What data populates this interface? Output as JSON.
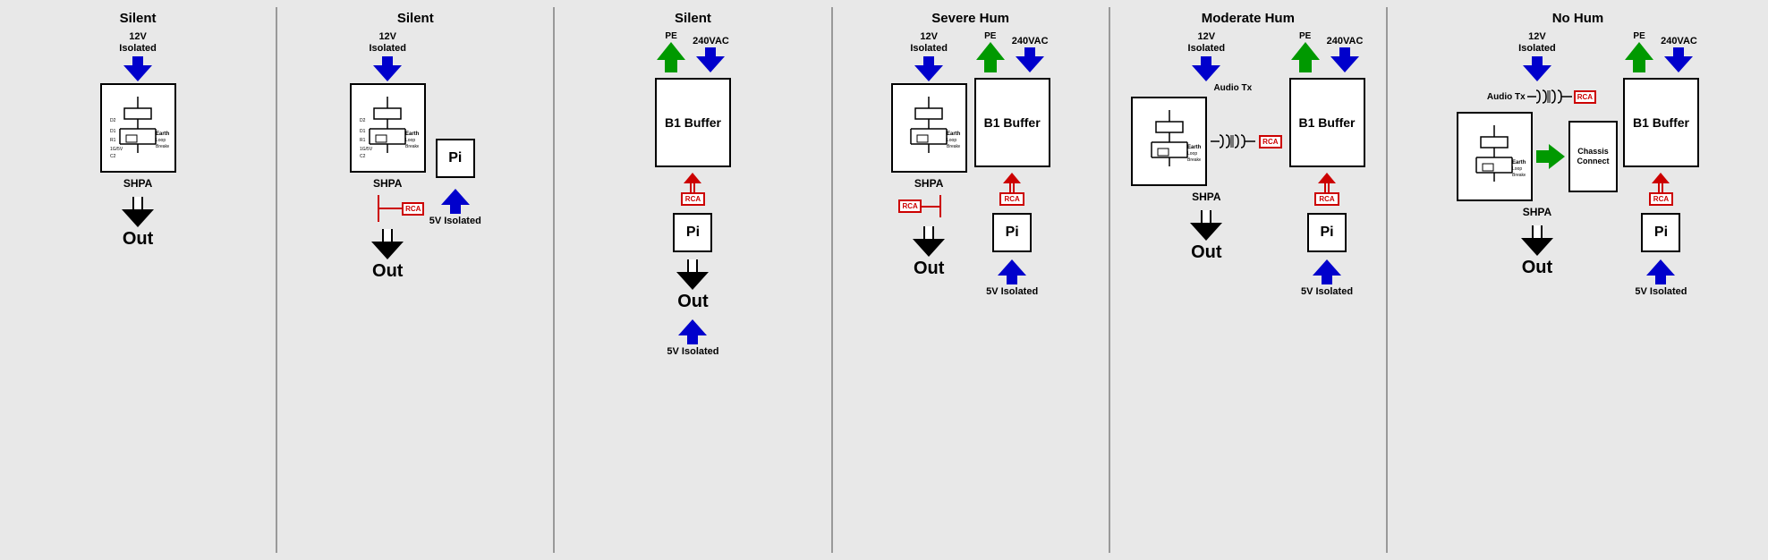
{
  "scenarios": [
    {
      "id": "s1",
      "title": "Silent",
      "columns": [
        {
          "type": "shpa",
          "topLabel": "12V\nIsolated",
          "showDownBlue": true,
          "showCircuit": true,
          "deviceLabel": "SHPA",
          "showOutArrow": true,
          "outLabel": "Out"
        }
      ]
    },
    {
      "id": "s2",
      "title": "Silent",
      "columns": [
        {
          "type": "shpa",
          "topLabel": "12V\nIsolated",
          "showDownBlue": true,
          "showCircuit": true,
          "deviceLabel": "SHPA",
          "showRcaRight": true,
          "showPi": true,
          "show5vIsolated": true,
          "showOutArrow": true,
          "outLabel": "Out"
        }
      ]
    },
    {
      "id": "s3",
      "title": "Silent",
      "columns": [
        {
          "type": "240vac_pe",
          "topLabel240": "240VAC",
          "topLabelPe": "PE",
          "showGreenUpArrow": true,
          "showBlueDownArrow": true
        },
        {
          "type": "b1buffer",
          "label": "B1 Buffer",
          "showRcaUp": true,
          "showPi": true,
          "show5vIsolated": true,
          "showOutArrow": true,
          "outLabel": "Out"
        }
      ]
    },
    {
      "id": "s4",
      "title": "Severe Hum",
      "columns": [
        {
          "type": "shpa_left",
          "topLabel": "12V\nIsolated",
          "showDownBlue": true,
          "showCircuit": true,
          "deviceLabel": "SHPA",
          "showRcaLeft": true,
          "showOutArrow": true,
          "outLabel": "Out"
        },
        {
          "type": "b1_right",
          "topLabel240": "240VAC",
          "topLabelPe": "PE",
          "showGreenUpArrow": true,
          "showBlueDownArrow": true,
          "label": "B1 Buffer",
          "showRcaUp": true,
          "showPi": true,
          "show5vIsolated": true
        }
      ]
    },
    {
      "id": "s5",
      "title": "Moderate Hum",
      "columns": [
        {
          "type": "shpa_left",
          "topLabel": "12V\nIsolated",
          "showDownBlue": true,
          "showCircuit": true,
          "deviceLabel": "SHPA",
          "showAudioTx": true,
          "showRcaLeft": true,
          "showOutArrow": true,
          "outLabel": "Out"
        },
        {
          "type": "b1_right",
          "topLabel240": "240VAC",
          "topLabelPe": "PE",
          "showGreenUpArrow": true,
          "showBlueDownArrow": true,
          "label": "B1 Buffer",
          "showRcaUp": true,
          "showPi": true,
          "show5vIsolated": true
        }
      ]
    },
    {
      "id": "s6",
      "title": "No Hum",
      "columns": [
        {
          "type": "shpa_chassis",
          "topLabel": "12V\nIsolated",
          "showDownBlue": true,
          "showCircuit": true,
          "deviceLabel": "SHPA",
          "showAudioTx": true,
          "showRcaLeft": true,
          "chassisLabel": "Chassis\nConnect",
          "showRightGreen": true,
          "showOutArrow": true,
          "outLabel": "Out"
        },
        {
          "type": "b1_right",
          "topLabel240": "240VAC",
          "topLabelPe": "PE",
          "showGreenUpArrow": true,
          "showBlueDownArrow": true,
          "label": "B1 Buffer",
          "showRcaUp": true,
          "showPi": true,
          "show5vIsolated": true
        }
      ]
    }
  ],
  "labels": {
    "silent": "Silent",
    "severeHum": "Severe Hum",
    "moderateHum": "Moderate Hum",
    "noHum": "No Hum",
    "shpa": "SHPA",
    "b1buffer": "B1 Buffer",
    "pi": "Pi",
    "out": "Out",
    "chassisConnect": "Chassis Connect",
    "rcaBadge": "RCA",
    "12vIsolated": "12V\nIsolated",
    "240vac": "240VAC",
    "5vIsolated": "5V Isolated",
    "pe": "PE",
    "audioTx": "Audio Tx"
  }
}
